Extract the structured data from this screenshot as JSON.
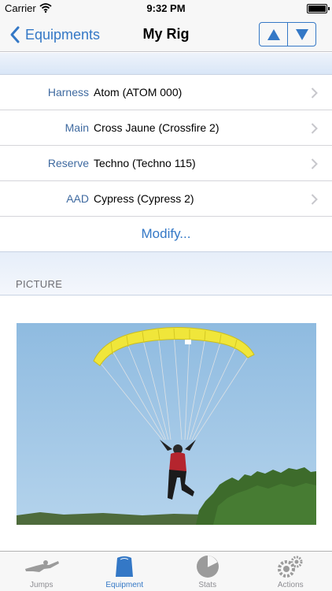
{
  "status_bar": {
    "carrier": "Carrier",
    "time": "9:32 PM"
  },
  "nav": {
    "back_label": "Equipments",
    "title": "My Rig",
    "up_icon": "triangle-up-icon",
    "down_icon": "triangle-down-icon"
  },
  "rows": [
    {
      "label": "Harness",
      "value": "Atom (ATOM 000)"
    },
    {
      "label": "Main",
      "value": "Cross Jaune (Crossfire 2)"
    },
    {
      "label": "Reserve",
      "value": "Techno (Techno 115)"
    },
    {
      "label": "AAD",
      "value": "Cypress (Cypress 2)"
    }
  ],
  "modify_label": "Modify...",
  "picture_section": {
    "header": "PICTURE"
  },
  "tabs": [
    {
      "label": "Jumps",
      "icon": "skydiver-icon",
      "active": false
    },
    {
      "label": "Equipment",
      "icon": "backpack-icon",
      "active": true
    },
    {
      "label": "Stats",
      "icon": "pie-chart-icon",
      "active": false
    },
    {
      "label": "Actions",
      "icon": "gears-icon",
      "active": false
    }
  ],
  "colors": {
    "accent": "#3478c6",
    "label_blue": "#3f6aa0",
    "canopy_yellow": "#f0e63a",
    "sky": "#9fc5e4"
  }
}
